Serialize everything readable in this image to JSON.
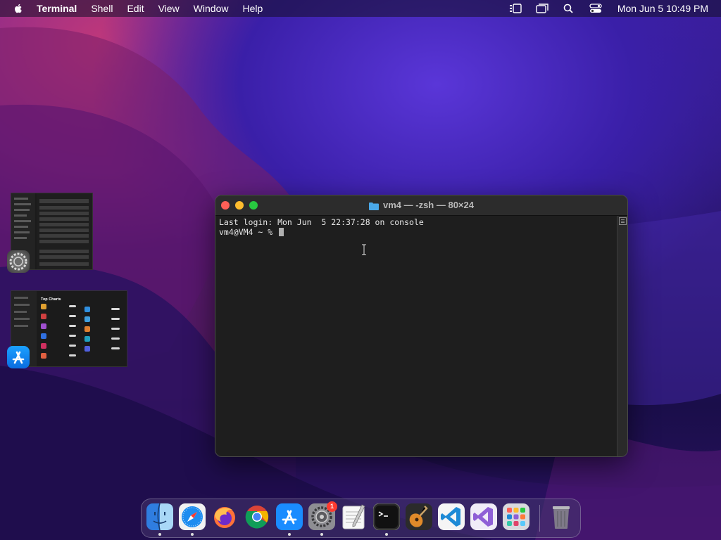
{
  "menubar": {
    "app_name": "Terminal",
    "menus": [
      "Shell",
      "Edit",
      "View",
      "Window",
      "Help"
    ],
    "clock": "Mon Jun 5  10:49 PM"
  },
  "terminal": {
    "title": "vm4 — -zsh — 80×24",
    "lines": [
      "Last login: Mon Jun  5 22:37:28 on console",
      "vm4@VM4 ~ % "
    ]
  },
  "previews": {
    "app_store_title": "Top Charts"
  },
  "dock": {
    "apps": [
      {
        "name": "Finder"
      },
      {
        "name": "Safari"
      },
      {
        "name": "Firefox"
      },
      {
        "name": "Chrome"
      },
      {
        "name": "App Store"
      },
      {
        "name": "System Preferences",
        "badge": "1"
      },
      {
        "name": "TextEdit"
      },
      {
        "name": "Terminal"
      },
      {
        "name": "GarageBand"
      },
      {
        "name": "Visual Studio Code"
      },
      {
        "name": "Visual Studio"
      },
      {
        "name": "Launchpad"
      },
      {
        "name": "Trash"
      }
    ]
  },
  "colors": {
    "close": "#ff5f57",
    "minimize": "#febc2e",
    "maximize": "#28c840",
    "terminal_bg": "#1e1e1e"
  }
}
